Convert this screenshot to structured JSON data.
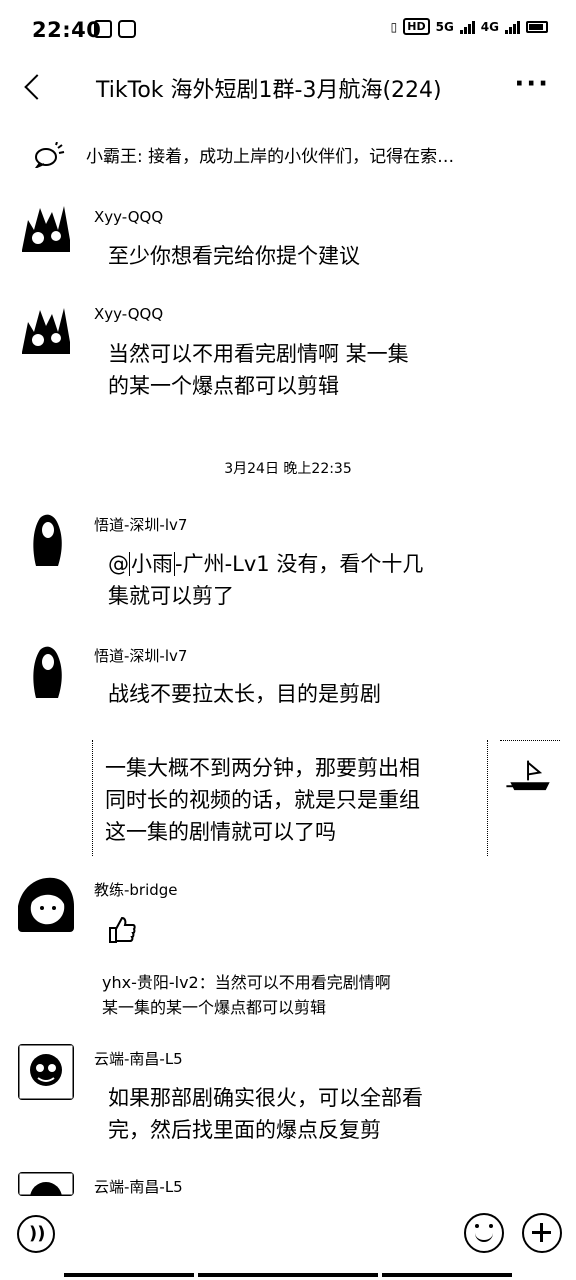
{
  "status": {
    "time": "22:40",
    "network_a": "5G",
    "network_b": "4G",
    "hd": "HD"
  },
  "header": {
    "title": "TikTok 海外短剧1群-3月航海(224)",
    "more": "···"
  },
  "notice": {
    "text": "小霸王: 接着，成功上岸的小伙伴们，记得在索…"
  },
  "messages": [
    {
      "sender": "Xyy-QQQ",
      "lines": [
        "至少你想看完给你提个建议"
      ]
    },
    {
      "sender": "Xyy-QQQ",
      "lines": [
        "当然可以不用看完剧情啊 某一集",
        "的某一个爆点都可以剪辑"
      ]
    },
    {
      "sender": "悟道-深圳-lv7",
      "mention": "小雨",
      "line1_rest": "-广州-Lv1 没有，看个十几",
      "line1_at": "@",
      "line2": "集就可以剪了"
    },
    {
      "sender": "悟道-深圳-lv7",
      "lines": [
        "战线不要拉太长，目的是剪剧"
      ]
    },
    {
      "sender": "教练-bridge",
      "emoji_name": "thumbs-up"
    },
    {
      "sender": "云端-南昌-L5",
      "lines": [
        "如果那部剧确实很火，可以全部看",
        "完，然后找里面的爆点反复剪"
      ]
    },
    {
      "sender": "云端-南昌-L5"
    }
  ],
  "timestamp": "3月24日 晚上22:35",
  "self_message": {
    "lines": [
      "一集大概不到两分钟，那要剪出相",
      "同时长的视频的话，就是只是重组",
      "这一集的剧情就可以了吗"
    ]
  },
  "quote": {
    "lines": [
      "yhx-贵阳-lv2：当然可以不用看完剧情啊",
      "某一集的某一个爆点都可以剪辑"
    ]
  },
  "icons": {
    "back": "back-chevron-icon",
    "more": "more-dots-icon",
    "notice": "speaker-icon",
    "voice": "voice-icon",
    "emoji": "emoji-icon",
    "plus": "plus-icon"
  }
}
